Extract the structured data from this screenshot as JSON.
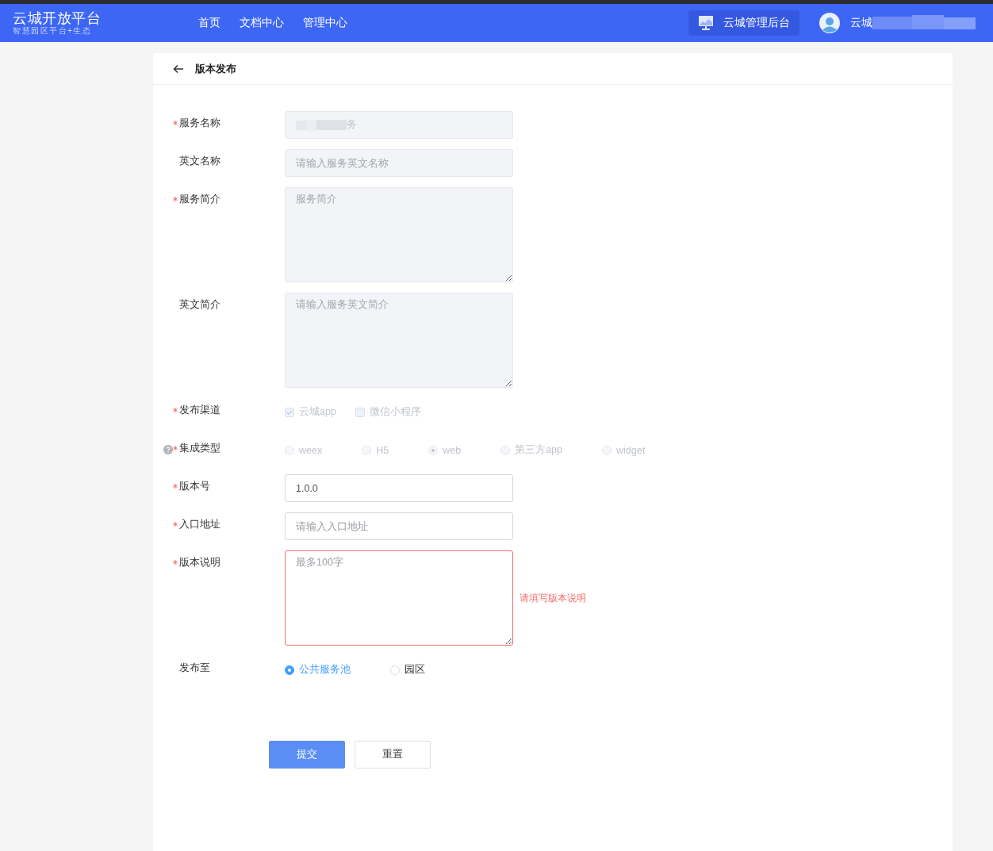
{
  "header": {
    "logo_title": "云城开放平台",
    "logo_subtitle": "智慧园区平台+生态",
    "nav": [
      "首页",
      "文档中心",
      "管理中心"
    ],
    "admin_button": "云城管理后台",
    "user_name": "云城"
  },
  "page": {
    "title": "版本发布"
  },
  "form": {
    "fields": [
      {
        "kind": "input",
        "label": "服务名称",
        "required": true,
        "value": "务",
        "disabled": true,
        "redacted": true
      },
      {
        "kind": "input",
        "label": "英文名称",
        "required": false,
        "placeholder": "请输入服务英文名称",
        "disabled": true
      },
      {
        "kind": "textarea",
        "label": "服务简介",
        "required": true,
        "placeholder": "服务简介",
        "disabled": true
      },
      {
        "kind": "textarea",
        "label": "英文简介",
        "required": false,
        "placeholder": "请输入服务英文简介",
        "disabled": true
      },
      {
        "kind": "checkbox",
        "label": "发布渠道",
        "required": true,
        "disabled": true,
        "options": [
          {
            "label": "云城app",
            "checked": true
          },
          {
            "label": "微信小程序",
            "checked": false
          }
        ]
      },
      {
        "kind": "radio",
        "label": "集成类型",
        "required": true,
        "help": true,
        "disabled": true,
        "options": [
          {
            "label": "weex",
            "selected": false
          },
          {
            "label": "H5",
            "selected": false
          },
          {
            "label": "web",
            "selected": true
          },
          {
            "label": "第三方app",
            "selected": false
          },
          {
            "label": "widget",
            "selected": false
          }
        ]
      },
      {
        "kind": "input",
        "label": "版本号",
        "required": true,
        "value": "1.0.0",
        "disabled": false
      },
      {
        "kind": "input",
        "label": "入口地址",
        "required": true,
        "placeholder": "请输入入口地址",
        "disabled": false
      },
      {
        "kind": "textarea",
        "label": "版本说明",
        "required": true,
        "placeholder": "最多100字",
        "disabled": false,
        "error": "请填写版本说明"
      },
      {
        "kind": "radio",
        "label": "发布至",
        "required": false,
        "disabled": false,
        "options": [
          {
            "label": "公共服务池",
            "selected": true
          },
          {
            "label": "园区",
            "selected": false
          }
        ]
      }
    ],
    "buttons": [
      {
        "label": "提交",
        "kind": "primary"
      },
      {
        "label": "重置",
        "kind": "default"
      }
    ]
  }
}
